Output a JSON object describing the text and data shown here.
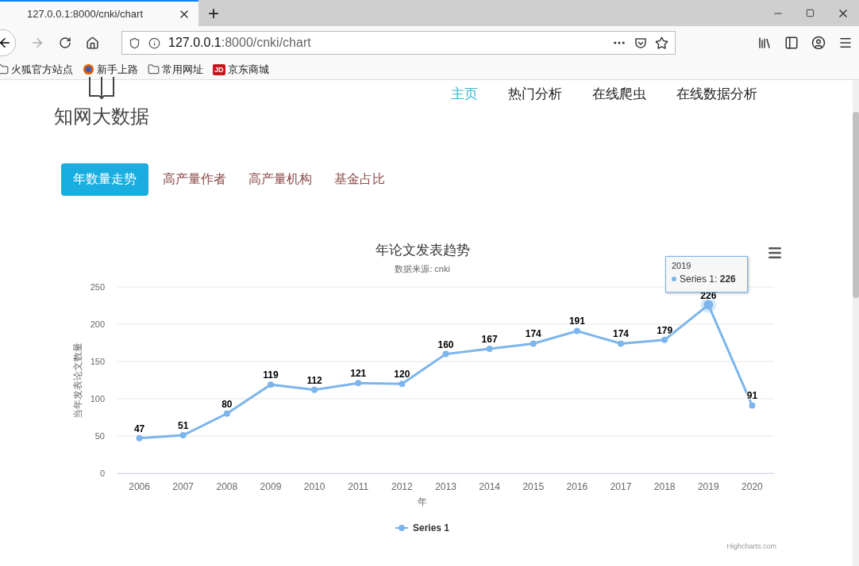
{
  "browser": {
    "tab_title": "127.0.0.1:8000/cnki/chart",
    "new_tab": "+",
    "url_host": "127.0.0.1",
    "url_path": ":8000/cnki/chart",
    "bookmarks": [
      {
        "kind": "folder",
        "label": "火狐官方站点"
      },
      {
        "kind": "browser",
        "label": "新手上路"
      },
      {
        "kind": "folder",
        "label": "常用网址"
      },
      {
        "kind": "badge",
        "badge": "JD",
        "label": "京东商城"
      }
    ]
  },
  "site": {
    "logo_text": "知网大数据",
    "nav": [
      {
        "label": "主页",
        "selected": true
      },
      {
        "label": "热门分析",
        "selected": false
      },
      {
        "label": "在线爬虫",
        "selected": false
      },
      {
        "label": "在线数据分析",
        "selected": false
      }
    ],
    "tabs": [
      {
        "label": "年数量走势",
        "selected": true
      },
      {
        "label": "高产量作者",
        "selected": false
      },
      {
        "label": "高产量机构",
        "selected": false
      },
      {
        "label": "基金占比",
        "selected": false
      }
    ],
    "chart": {
      "chart_data": {
        "type": "line",
        "title": "年论文发表趋势",
        "subtitle": "数据来源: cnki",
        "xlabel": "年",
        "ylabel": "当年发表论文数量",
        "categories": [
          "2006",
          "2007",
          "2008",
          "2009",
          "2010",
          "2011",
          "2012",
          "2013",
          "2014",
          "2015",
          "2016",
          "2017",
          "2018",
          "2019",
          "2020"
        ],
        "series": [
          {
            "name": "Series 1",
            "color": "#7cb5ec",
            "marker": true,
            "values": [
              47,
              51,
              80,
              119,
              112,
              121,
              120,
              160,
              167,
              174,
              191,
              174,
              179,
              226,
              91
            ]
          }
        ],
        "ylim": [
          0,
          250
        ],
        "grid": true,
        "yticks": [
          0,
          50,
          100,
          150,
          200,
          250
        ],
        "data_labels": true
      },
      "tooltip": {
        "header": "2019",
        "text": "Series 1: **226**"
      },
      "credit": "Highcharts.com"
    }
  }
}
